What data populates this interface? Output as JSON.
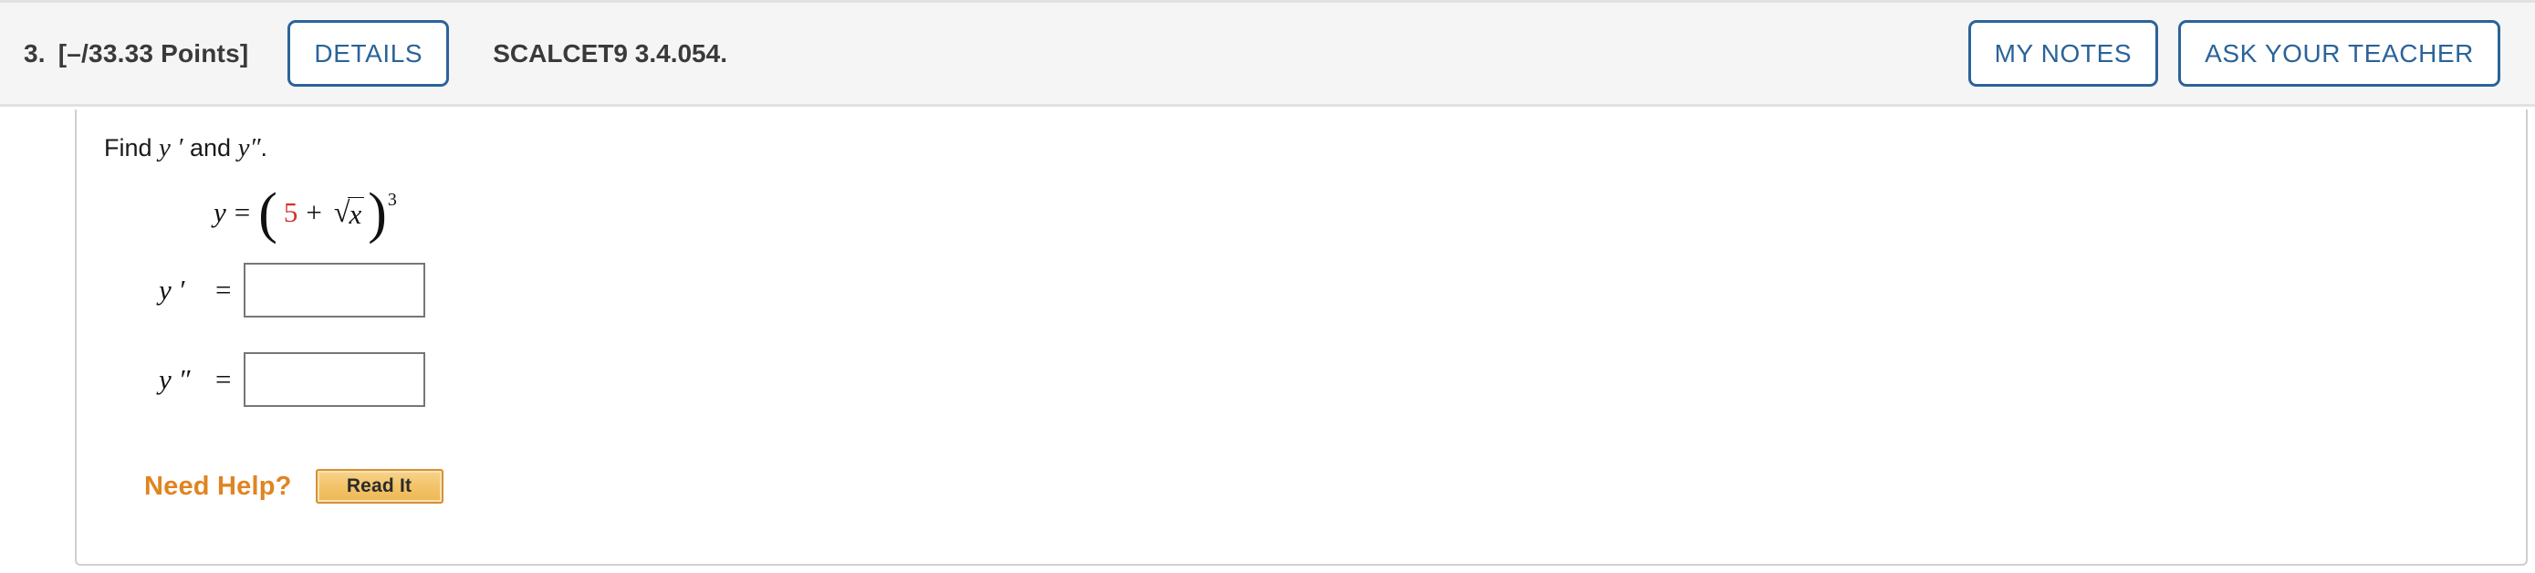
{
  "header": {
    "question_number": "3.",
    "points": "[–/33.33 Points]",
    "details_label": "DETAILS",
    "reference": "SCALCET9 3.4.054.",
    "my_notes_label": "MY NOTES",
    "ask_teacher_label": "ASK YOUR TEACHER",
    "accent_blue": "#2b6399",
    "background": "#f5f5f5"
  },
  "problem": {
    "prompt_prefix": "Find ",
    "prompt_var1": "y",
    "prompt_prime1": " ′",
    "prompt_mid": " and ",
    "prompt_var2": "y",
    "prompt_prime2": "″",
    "prompt_end": ".",
    "equation": {
      "lhs": "y",
      "equals": "=",
      "open_paren": "(",
      "coefficient": "5",
      "plus": "+",
      "radical_sign": "√",
      "radicand": "x",
      "close_paren": ")",
      "exponent": "3",
      "coefficient_color": "#d0342c",
      "plain_text": "y = (5 + √x)^3"
    },
    "answers": [
      {
        "label": "y ′",
        "equals": "=",
        "value": "",
        "placeholder": ""
      },
      {
        "label": "y ″",
        "equals": "=",
        "value": "",
        "placeholder": ""
      }
    ]
  },
  "help": {
    "label": "Need Help?",
    "read_it_label": "Read It",
    "label_color": "#e08421",
    "button_color": "#f0c469"
  }
}
